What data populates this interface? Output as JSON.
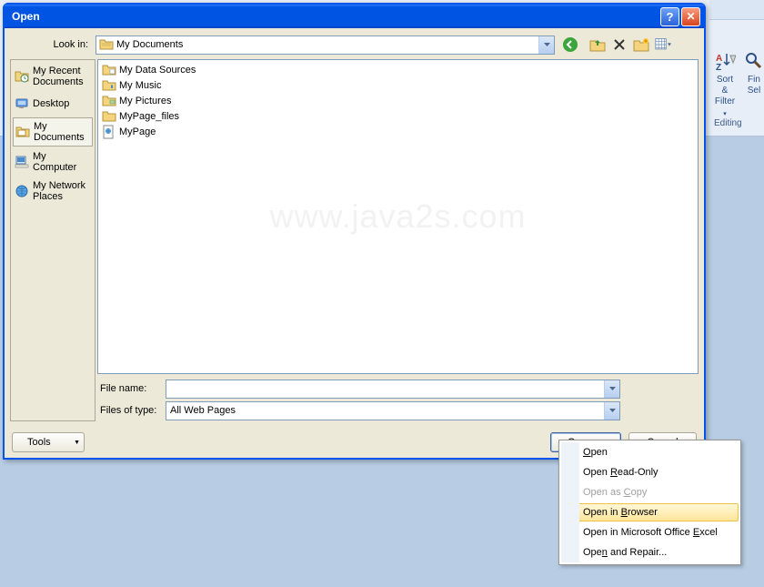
{
  "dialog": {
    "title": "Open",
    "lookin_label": "Look in:",
    "lookin_value": "My Documents",
    "filename_label": "File name:",
    "filename_value": "",
    "filetype_label": "Files of type:",
    "filetype_value": "All Web Pages",
    "tools_label": "Tools",
    "open_label": "Open",
    "cancel_label": "Cancel"
  },
  "places": [
    {
      "label": "My Recent Documents",
      "icon": "recent"
    },
    {
      "label": "Desktop",
      "icon": "desktop"
    },
    {
      "label": "My Documents",
      "icon": "mydocs",
      "selected": true
    },
    {
      "label": "My Computer",
      "icon": "mycomputer"
    },
    {
      "label": "My Network Places",
      "icon": "network"
    }
  ],
  "files": [
    {
      "name": "My Data Sources",
      "icon": "folder-special"
    },
    {
      "name": "My Music",
      "icon": "folder-special"
    },
    {
      "name": "My Pictures",
      "icon": "folder-special"
    },
    {
      "name": "MyPage_files",
      "icon": "folder"
    },
    {
      "name": "MyPage",
      "icon": "webpage"
    }
  ],
  "menu": {
    "items": [
      {
        "label": "Open",
        "accel": "O"
      },
      {
        "label": "Open Read-Only",
        "accel": "R"
      },
      {
        "label": "Open as Copy",
        "accel": "C",
        "disabled": true
      },
      {
        "label": "Open in Browser",
        "accel": "B",
        "highlight": true
      },
      {
        "label": "Open in Microsoft Office Excel",
        "accel": "E"
      },
      {
        "label": "Open and Repair...",
        "accel": ""
      }
    ]
  },
  "ribbon": {
    "sort_label": "Sort &",
    "filter_label": "Filter",
    "find_label": "Fin",
    "select_label": "Sel",
    "group_label": "Editing"
  },
  "watermark": "www.java2s.com"
}
